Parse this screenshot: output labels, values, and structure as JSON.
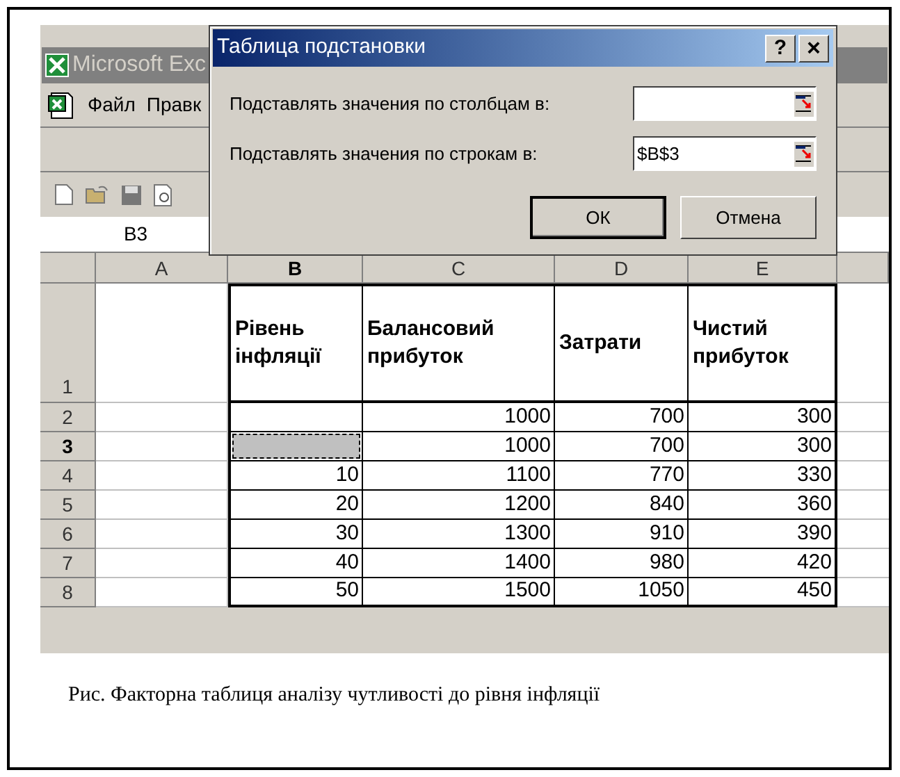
{
  "excel": {
    "title": "Microsoft Exc",
    "menu": [
      "Файл",
      "Правк"
    ],
    "name_box": "B3"
  },
  "sheet": {
    "columns": [
      {
        "label": "A",
        "selected": false
      },
      {
        "label": "B",
        "selected": true
      },
      {
        "label": "C",
        "selected": false
      },
      {
        "label": "D",
        "selected": false
      },
      {
        "label": "E",
        "selected": false
      }
    ],
    "rows": [
      {
        "header": "1",
        "selected": false,
        "kind": "heading",
        "cells": [
          "",
          "Рівень інфляції",
          "Балансовий прибуток",
          "Затрати",
          "Чистий прибуток"
        ]
      },
      {
        "header": "2",
        "selected": false,
        "kind": "data",
        "cells": [
          "",
          "",
          "1000",
          "700",
          "300"
        ]
      },
      {
        "header": "3",
        "selected": true,
        "kind": "data",
        "cells": [
          "",
          "",
          "1000",
          "700",
          "300"
        ]
      },
      {
        "header": "4",
        "selected": false,
        "kind": "data",
        "cells": [
          "",
          "10",
          "1100",
          "770",
          "330"
        ]
      },
      {
        "header": "5",
        "selected": false,
        "kind": "data",
        "cells": [
          "",
          "20",
          "1200",
          "840",
          "360"
        ]
      },
      {
        "header": "6",
        "selected": false,
        "kind": "data",
        "cells": [
          "",
          "30",
          "1300",
          "910",
          "390"
        ]
      },
      {
        "header": "7",
        "selected": false,
        "kind": "data",
        "cells": [
          "",
          "40",
          "1400",
          "980",
          "420"
        ]
      },
      {
        "header": "8",
        "selected": false,
        "kind": "data",
        "cells": [
          "",
          "50",
          "1500",
          "1050",
          "450"
        ]
      }
    ]
  },
  "dialog": {
    "title": "Таблица подстановки",
    "help": "?",
    "close": "×",
    "fields": [
      {
        "label": "Подставлять значения по столбцам в:"
      },
      {
        "label": "Подставлять значения по строкам в:",
        "value": "$B$3"
      }
    ],
    "buttons": [
      {
        "label": "ОК",
        "default": true
      },
      {
        "label": "Отмена",
        "default": false
      }
    ]
  },
  "caption": "Рис. Факторна таблиця аналізу чутливості до рівня інфляції"
}
